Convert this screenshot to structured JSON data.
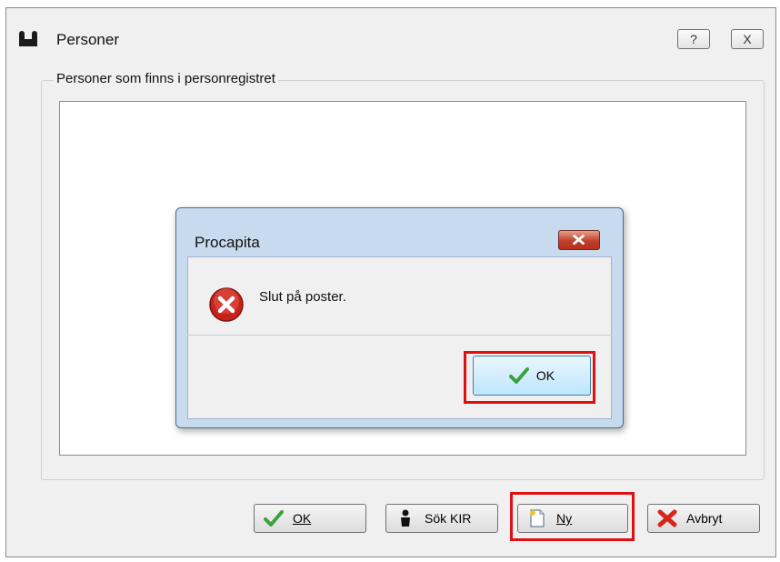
{
  "window": {
    "title": "Personer",
    "help_label": "?",
    "close_label": "X"
  },
  "group": {
    "label": "Personer som finns i personregistret"
  },
  "buttons": {
    "ok": "OK",
    "sok_kir": "Sök KIR",
    "ny": "Ny",
    "avbryt": "Avbryt"
  },
  "dialog": {
    "title": "Procapita",
    "message": "Slut på poster.",
    "ok": "OK"
  },
  "colors": {
    "highlight": "#e01010",
    "dialog_frame": "#c8dbee",
    "error_icon": "#c8221a",
    "check_icon": "#3ca23c"
  },
  "icons": {
    "app": "people-icon",
    "error": "error-icon",
    "check": "check-icon",
    "person": "person-icon",
    "new_document": "new-document-icon",
    "cancel": "red-x-icon"
  }
}
